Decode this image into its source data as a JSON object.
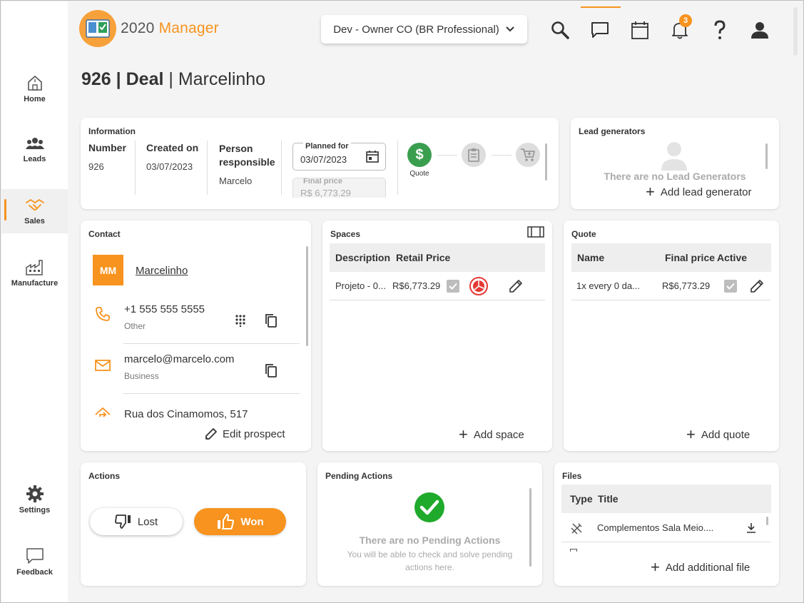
{
  "app": {
    "logo_text_a": "2020",
    "logo_text_b": " Manager"
  },
  "company_selector": "Dev - Owner CO (BR Professional)",
  "notifications_count": "3",
  "sidebar": {
    "items": [
      {
        "label": "Home"
      },
      {
        "label": "Leads"
      },
      {
        "label": "Sales"
      },
      {
        "label": "Manufacture"
      },
      {
        "label": "Settings"
      },
      {
        "label": "Feedback"
      }
    ]
  },
  "page": {
    "title_id": "926",
    "title_sep": " | ",
    "title_type": "Deal",
    "title_name": "Marcelinho"
  },
  "information": {
    "title": "Information",
    "number_label": "Number",
    "number_value": "926",
    "created_label": "Created on",
    "created_value": "03/07/2023",
    "person_label_1": "Person",
    "person_label_2": "responsible",
    "person_value": "Marcelo",
    "planned_label": "Planned for",
    "planned_value": "03/07/2023",
    "final_price_label": "Final price",
    "final_price_value": "R$ 6,773.29",
    "stage_quote_label": "Quote"
  },
  "lead_generators": {
    "title": "Lead generators",
    "empty_text": "There are no Lead Generators",
    "add_label": "Add lead generator"
  },
  "contact": {
    "title": "Contact",
    "initials": "MM",
    "name": "Marcelinho",
    "phone": "+1 555 555 5555",
    "phone_type": "Other",
    "email": "marcelo@marcelo.com",
    "email_type": "Business",
    "address": "Rua dos Cinamomos, 517",
    "edit_label": "Edit prospect"
  },
  "spaces": {
    "title": "Spaces",
    "headers": [
      "Description",
      "Retail Price"
    ],
    "rows": [
      {
        "description": "Projeto - 0...",
        "price": "R$6,773.29"
      }
    ],
    "add_label": "Add space"
  },
  "quote": {
    "title": "Quote",
    "headers": [
      "Name",
      "Final price",
      "Active"
    ],
    "rows": [
      {
        "name": "1x every 0 da...",
        "price": "R$6,773.29"
      }
    ],
    "add_label": "Add quote"
  },
  "actions": {
    "title": "Actions",
    "lost_label": "Lost",
    "won_label": "Won"
  },
  "pending": {
    "title": "Pending Actions",
    "empty_title": "There are no Pending Actions",
    "empty_sub_1": "You will be able to check and solve pending",
    "empty_sub_2": "actions here."
  },
  "files": {
    "title": "Files",
    "headers": [
      "Type",
      "Title"
    ],
    "rows": [
      {
        "title": "Complementos Sala Meio...."
      }
    ],
    "add_label": "Add additional file"
  },
  "colors": {
    "accent": "#f7931e",
    "quote_green": "#3a9e4f",
    "check_green": "#1faa2b",
    "spin_red": "#e53935"
  }
}
